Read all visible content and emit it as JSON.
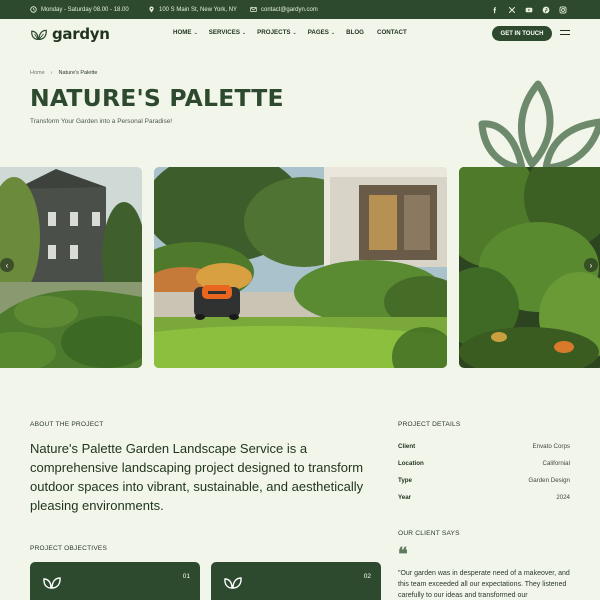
{
  "topbar": {
    "hours": "Monday - Saturday 08.00 - 18.00",
    "address": "100 S Main St, New York, NY",
    "email": "contact@gardyn.com",
    "socials": [
      "facebook-icon",
      "x-icon",
      "youtube-icon",
      "pinterest-icon",
      "instagram-icon"
    ]
  },
  "header": {
    "logo": "gardyn",
    "nav": [
      {
        "label": "HOME",
        "dropdown": true
      },
      {
        "label": "SERVICES",
        "dropdown": true
      },
      {
        "label": "PROJECTS",
        "dropdown": true
      },
      {
        "label": "PAGES",
        "dropdown": true
      },
      {
        "label": "BLOG",
        "dropdown": false
      },
      {
        "label": "CONTACT",
        "dropdown": false
      }
    ],
    "cta": "GET IN TOUCH"
  },
  "breadcrumb": {
    "home": "Home",
    "sep": "›",
    "current": "Nature's Palette"
  },
  "hero": {
    "title": "NATURE'S PALETTE",
    "subtitle": "Transform Your Garden into a Personal Paradise!"
  },
  "gallery": {
    "prev": "‹",
    "next": "›"
  },
  "about": {
    "label": "ABOUT THE PROJECT",
    "text": "Nature's Palette Garden Landscape Service is a comprehensive landscaping project designed to transform outdoor spaces into vibrant, sustainable, and aesthetically pleasing environments."
  },
  "details": {
    "label": "PROJECT DETAILS",
    "rows": [
      {
        "k": "Client",
        "v": "Envato Corps"
      },
      {
        "k": "Location",
        "v": "Californial"
      },
      {
        "k": "Type",
        "v": "Garden Design"
      },
      {
        "k": "Year",
        "v": "2024"
      }
    ]
  },
  "client": {
    "label": "OUR CLIENT SAYS",
    "quote": "\"Our garden was in desperate need of a makeover, and this team exceeded all our expectations. They listened carefully to our ideas and transformed our"
  },
  "objectives": {
    "label": "PROJECT OBJECTIVES",
    "cards": [
      {
        "num": "01"
      },
      {
        "num": "02"
      }
    ]
  },
  "colors": {
    "primary": "#2d4a2e",
    "background": "#f2f5ea",
    "accent_leaf": "#6e8a6c"
  }
}
